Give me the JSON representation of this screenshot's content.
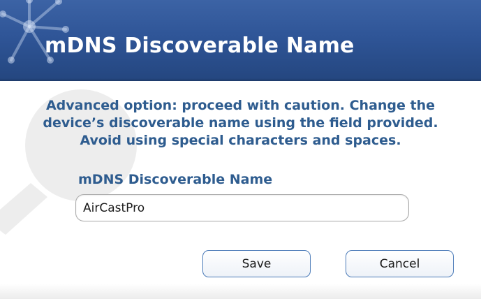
{
  "header": {
    "title": "mDNS Discoverable Name",
    "logo_icon": "network-node-icon",
    "bg_color": "#2f5597"
  },
  "warning": {
    "line1": "Advanced option: proceed with caution. Change the",
    "line2": "device’s discoverable name using the field provided.",
    "line3": "Avoid using special characters and spaces.",
    "color": "#2e5c8f"
  },
  "form": {
    "label": "mDNS Discoverable Name",
    "input_value": "AirCastPro"
  },
  "buttons": {
    "save_label": "Save",
    "cancel_label": "Cancel"
  },
  "overlay": {
    "icon": "magnifier-watermark-icon"
  }
}
